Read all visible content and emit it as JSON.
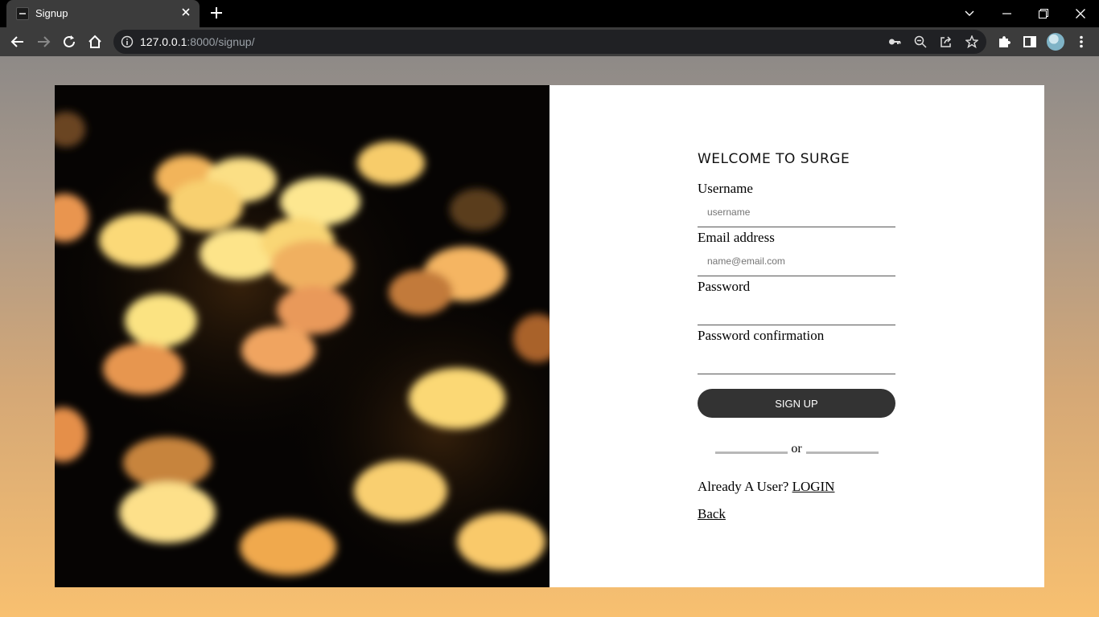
{
  "browser": {
    "tab_title": "Signup",
    "url_host": "127.0.0.1",
    "url_path": ":8000/signup/"
  },
  "icons": {
    "tab_favicon": "site-favicon",
    "tab_close": "close-icon",
    "new_tab": "plus-icon",
    "back": "arrow-left-icon",
    "forward": "arrow-right-icon",
    "reload": "reload-icon",
    "home": "home-icon",
    "site_info": "info-icon",
    "password_key": "key-icon",
    "zoom": "zoom-out-icon",
    "share": "share-icon",
    "bookmark": "star-icon",
    "extensions": "puzzle-icon",
    "side_panel": "side-panel-icon",
    "menu": "kebab-menu-icon"
  },
  "signup": {
    "heading": "WELCOME TO SURGE",
    "username_label": "Username",
    "username_placeholder": "username",
    "email_label": "Email address",
    "email_placeholder": "name@email.com",
    "password_label": "Password",
    "password_confirm_label": "Password confirmation",
    "submit_label": "SIGN UP",
    "or_text": "or",
    "login_prompt": "Already A User?",
    "login_link": "LOGIN",
    "back_link": "Back"
  },
  "colors": {
    "button_bg": "#333333",
    "panel_bg": "#ffffff",
    "page_gradient_top": "#8e8a87",
    "page_gradient_bottom": "#f8c070"
  }
}
